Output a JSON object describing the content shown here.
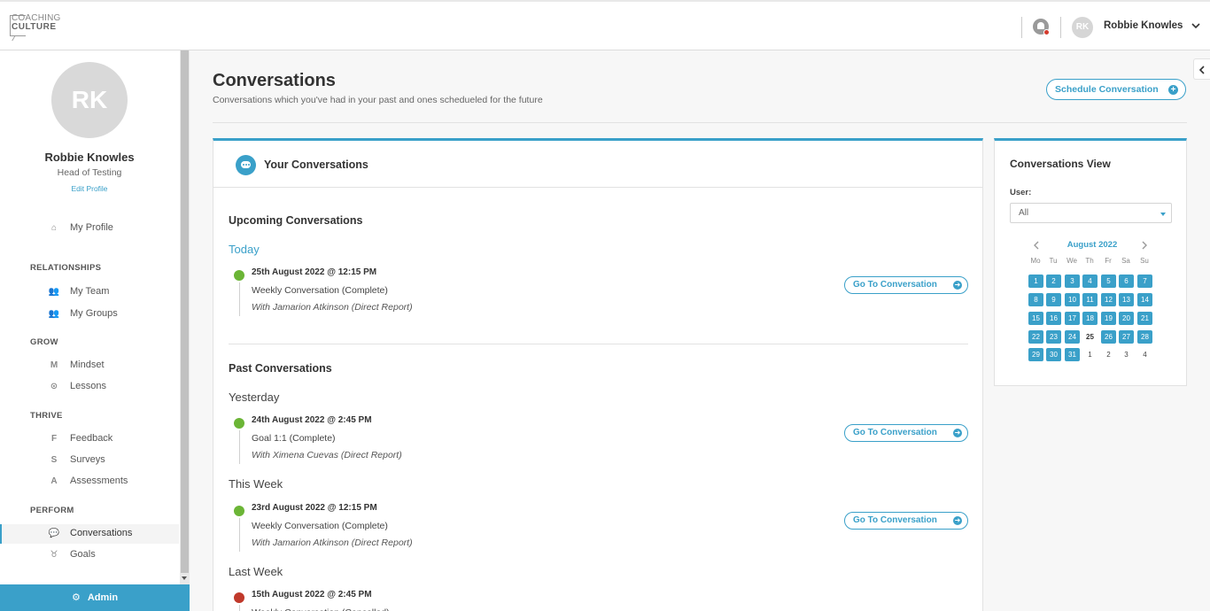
{
  "header": {
    "logo_line1": "COACHING",
    "logo_line2": "CULTURE",
    "user_initials": "RK",
    "user_name": "Robbie Knowles"
  },
  "sidebar": {
    "initials": "RK",
    "name": "Robbie Knowles",
    "role": "Head of Testing",
    "edit_profile": "Edit Profile",
    "my_profile": "My Profile",
    "sections": {
      "relationships": "RELATIONSHIPS",
      "grow": "GROW",
      "thrive": "THRIVE",
      "perform": "PERFORM"
    },
    "items": {
      "my_team": "My Team",
      "my_groups": "My Groups",
      "mindset": "Mindset",
      "lessons": "Lessons",
      "feedback": "Feedback",
      "surveys": "Surveys",
      "assessments": "Assessments",
      "conversations": "Conversations",
      "goals": "Goals"
    },
    "icons": {
      "mindset": "M",
      "feedback": "F",
      "surveys": "S",
      "assessments": "A"
    },
    "admin": "Admin"
  },
  "page": {
    "title": "Conversations",
    "subtitle": "Conversations which you've had in your past and ones schedueled for the future",
    "schedule_button": "Schedule Conversation"
  },
  "conversations_card": {
    "title": "Your Conversations",
    "upcoming_title": "Upcoming Conversations",
    "past_title": "Past Conversations",
    "go_button": "Go To Conversation",
    "groups": {
      "today": "Today",
      "yesterday": "Yesterday",
      "this_week": "This Week",
      "last_week": "Last Week"
    },
    "items": [
      {
        "date": "25th August 2022 @ 12:15 PM",
        "type": "Weekly Conversation (Complete)",
        "with": "With Jamarion Atkinson (Direct Report)",
        "status_color": "#6bb536"
      },
      {
        "date": "24th August 2022 @ 2:45 PM",
        "type": "Goal 1:1 (Complete)",
        "with": "With Ximena Cuevas (Direct Report)",
        "status_color": "#6bb536"
      },
      {
        "date": "23rd August 2022 @ 12:15 PM",
        "type": "Weekly Conversation (Complete)",
        "with": "With Jamarion Atkinson (Direct Report)",
        "status_color": "#6bb536"
      },
      {
        "date": "15th August 2022 @ 2:45 PM",
        "type": "Weekly Conversation (Cancelled)",
        "with": "",
        "status_color": "#c0392b"
      }
    ]
  },
  "conversations_view": {
    "title": "Conversations View",
    "user_label": "User:",
    "user_value": "All",
    "month": "August 2022",
    "weekdays": [
      "Mo",
      "Tu",
      "We",
      "Th",
      "Fr",
      "Sa",
      "Su"
    ],
    "weeks": [
      [
        "1",
        "2",
        "3",
        "4",
        "5",
        "6",
        "7"
      ],
      [
        "8",
        "9",
        "10",
        "11",
        "12",
        "13",
        "14"
      ],
      [
        "15",
        "16",
        "17",
        "18",
        "19",
        "20",
        "21"
      ],
      [
        "22",
        "23",
        "24",
        "25",
        "26",
        "27",
        "28"
      ],
      [
        "29",
        "30",
        "31",
        "1",
        "2",
        "3",
        "4"
      ]
    ],
    "today_day": "25"
  },
  "colors": {
    "accent": "#3aa0c9",
    "complete": "#6bb536",
    "cancelled": "#c0392b"
  }
}
